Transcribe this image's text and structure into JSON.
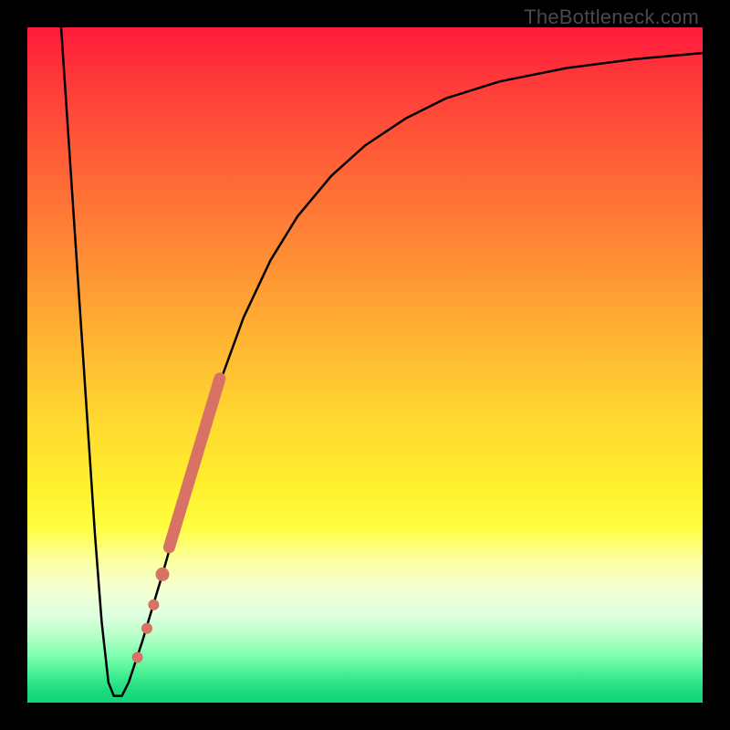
{
  "watermark": "TheBottleneck.com",
  "chart_data": {
    "type": "line",
    "title": "",
    "xlabel": "",
    "ylabel": "",
    "xlim": [
      0,
      100
    ],
    "ylim": [
      0,
      100
    ],
    "series": [
      {
        "name": "bottleneck-curve",
        "style": "black-line",
        "points": [
          {
            "x": 5.0,
            "y": 100.0
          },
          {
            "x": 6.0,
            "y": 85.0
          },
          {
            "x": 7.0,
            "y": 70.0
          },
          {
            "x": 8.0,
            "y": 55.0
          },
          {
            "x": 9.0,
            "y": 40.0
          },
          {
            "x": 10.0,
            "y": 25.0
          },
          {
            "x": 11.0,
            "y": 12.0
          },
          {
            "x": 12.0,
            "y": 3.0
          },
          {
            "x": 12.8,
            "y": 1.0
          },
          {
            "x": 14.0,
            "y": 1.0
          },
          {
            "x": 15.0,
            "y": 3.0
          },
          {
            "x": 17.0,
            "y": 9.0
          },
          {
            "x": 20.0,
            "y": 19.0
          },
          {
            "x": 24.0,
            "y": 33.0
          },
          {
            "x": 28.0,
            "y": 46.0
          },
          {
            "x": 32.0,
            "y": 57.0
          },
          {
            "x": 36.0,
            "y": 65.5
          },
          {
            "x": 40.0,
            "y": 72.0
          },
          {
            "x": 45.0,
            "y": 78.0
          },
          {
            "x": 50.0,
            "y": 82.5
          },
          {
            "x": 56.0,
            "y": 86.5
          },
          {
            "x": 62.0,
            "y": 89.5
          },
          {
            "x": 70.0,
            "y": 92.0
          },
          {
            "x": 80.0,
            "y": 94.0
          },
          {
            "x": 90.0,
            "y": 95.3
          },
          {
            "x": 100.0,
            "y": 96.2
          }
        ]
      },
      {
        "name": "highlight-segment",
        "style": "thick-salmon",
        "points": [
          {
            "x": 21.0,
            "y": 23.0
          },
          {
            "x": 28.5,
            "y": 48.0
          }
        ]
      },
      {
        "name": "highlight-dots",
        "style": "salmon-dots",
        "points": [
          {
            "x": 20.0,
            "y": 19.0
          },
          {
            "x": 18.7,
            "y": 14.5
          },
          {
            "x": 17.7,
            "y": 11.0
          },
          {
            "x": 16.3,
            "y": 6.7
          }
        ]
      }
    ]
  }
}
